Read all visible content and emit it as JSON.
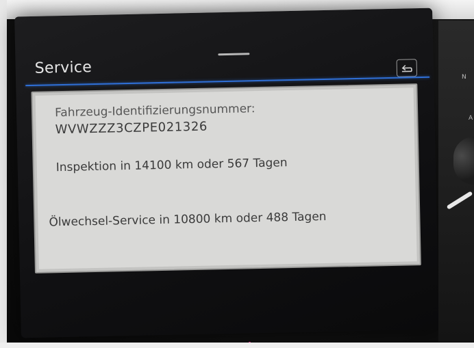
{
  "screen": {
    "title": "Service",
    "back_icon": "return-arrow-icon"
  },
  "dialog": {
    "vin_label": "Fahrzeug-Identifizierungsnummer:",
    "vin_value": "WVWZZZ3CZPE021326",
    "inspection": "Inspektion in 14100 km oder 567 Tagen",
    "oil_service": "Ölwechsel-Service in 10800 km oder 488 Tagen"
  },
  "side_panel": {
    "label_top": "N",
    "label_mid": "A"
  },
  "colors": {
    "accent_line": "#2f6fd6",
    "dialog_background": "#d9d9d7",
    "screen_background": "#111113"
  }
}
